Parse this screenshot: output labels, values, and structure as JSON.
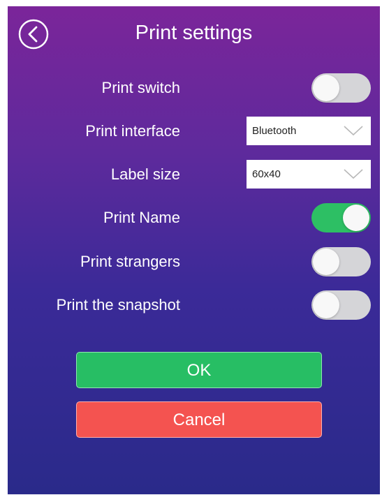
{
  "header": {
    "title": "Print settings",
    "back_icon": "chevron-left-circle-icon"
  },
  "settings": {
    "print_switch": {
      "label": "Print switch",
      "enabled": false
    },
    "print_interface": {
      "label": "Print interface",
      "value": "Bluetooth"
    },
    "label_size": {
      "label": "Label size",
      "value": "60x40"
    },
    "print_name": {
      "label": "Print Name",
      "enabled": true
    },
    "print_strangers": {
      "label": "Print strangers",
      "enabled": false
    },
    "print_snapshot": {
      "label": "Print the snapshot",
      "enabled": false
    }
  },
  "buttons": {
    "ok_label": "OK",
    "cancel_label": "Cancel"
  },
  "colors": {
    "background_top": "#7b259a",
    "background_bottom": "#2a2a8a",
    "toggle_on": "#2dbf64",
    "toggle_off": "#d5d5d8",
    "ok": "#27be64",
    "cancel": "#f45350"
  }
}
